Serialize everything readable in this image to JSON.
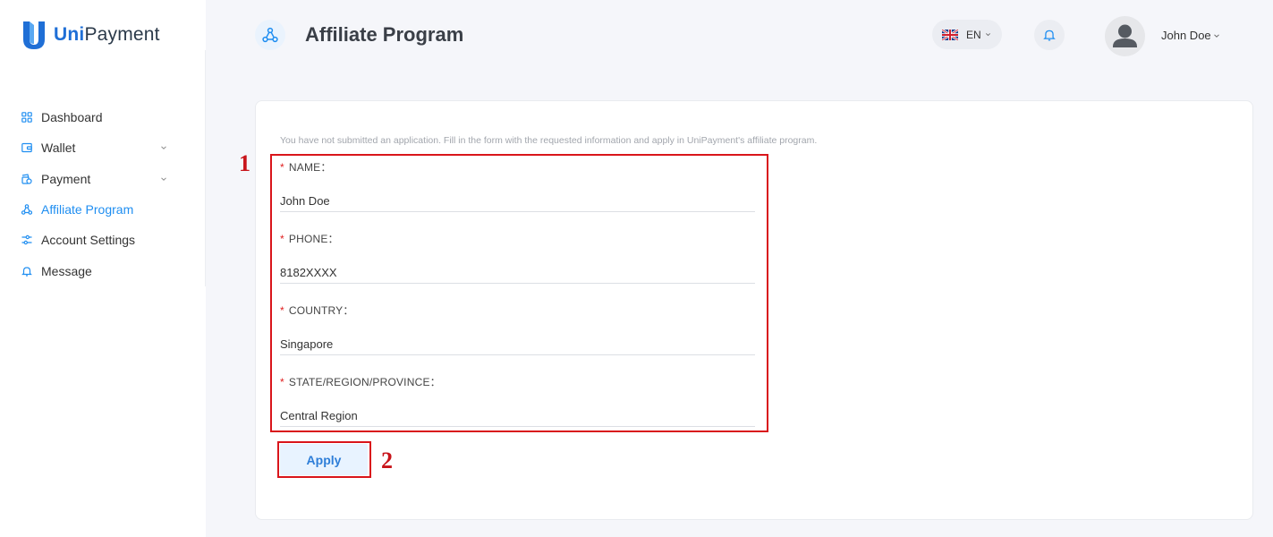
{
  "app": {
    "brand_prefix": "Uni",
    "brand_suffix": "Payment"
  },
  "sidebar": {
    "items": [
      {
        "label": "Dashboard",
        "icon": "grid-icon"
      },
      {
        "label": "Wallet",
        "icon": "wallet-icon",
        "expandable": true
      },
      {
        "label": "Payment",
        "icon": "payment-icon",
        "expandable": true
      },
      {
        "label": "Affiliate Program",
        "icon": "network-icon",
        "active": true
      },
      {
        "label": "Account Settings",
        "icon": "sliders-icon"
      },
      {
        "label": "Message",
        "icon": "bell-icon"
      }
    ]
  },
  "header": {
    "title": "Affiliate Program",
    "language": "EN",
    "user_name": "John Doe"
  },
  "form": {
    "notice": "You have not submitted an application. Fill in the form with the requested information and apply in UniPayment's affiliate program.",
    "required_mark": "*",
    "fields": [
      {
        "label": "NAME：",
        "value": "John Doe"
      },
      {
        "label": "PHONE：",
        "value": "8182XXXX"
      },
      {
        "label": "COUNTRY：",
        "value": "Singapore"
      },
      {
        "label": "STATE/REGION/PROVINCE：",
        "value": "Central Region"
      }
    ],
    "apply_label": "Apply"
  },
  "annotations": {
    "box1_number": "1",
    "box2_number": "2"
  },
  "colors": {
    "accent": "#1f8ef1",
    "brand": "#1f6fd6",
    "annotation": "#d9151b",
    "required": "#e02020"
  }
}
